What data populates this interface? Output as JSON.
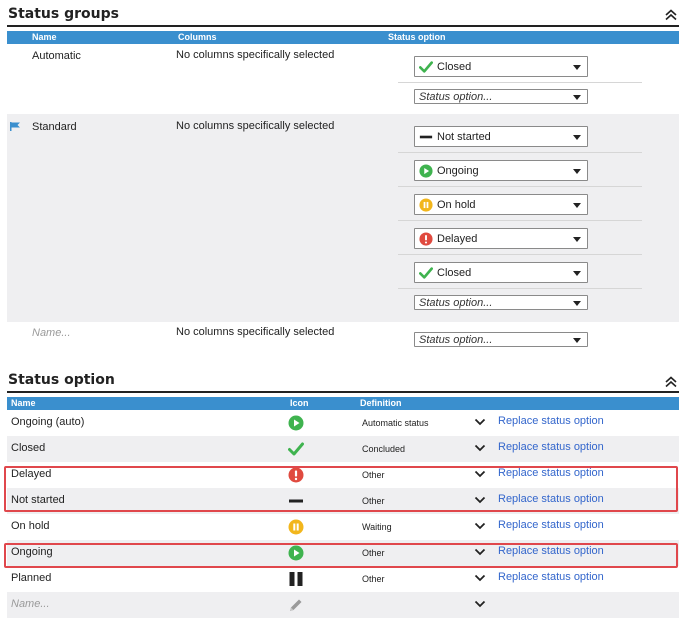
{
  "status_groups": {
    "title": "Status groups",
    "headers": {
      "name": "Name",
      "columns": "Columns",
      "status_option": "Status option"
    },
    "groups": [
      {
        "name": "Automatic",
        "columns": "No columns specifically selected",
        "options": [
          "Closed"
        ],
        "add_placeholder": "Status option..."
      },
      {
        "name": "Standard",
        "columns": "No columns specifically selected",
        "options": [
          "Not started",
          "Ongoing",
          "On hold",
          "Delayed",
          "Closed"
        ],
        "add_placeholder": "Status option..."
      }
    ],
    "new_row": {
      "name_placeholder": "Name...",
      "columns": "No columns specifically selected",
      "add_placeholder": "Status option..."
    }
  },
  "status_option": {
    "title": "Status option",
    "headers": {
      "name": "Name",
      "icon": "Icon",
      "definition": "Definition"
    },
    "rows": [
      {
        "name": "Ongoing (auto)",
        "icon": "play-circle-green",
        "definition": "Automatic status",
        "action": "Replace status option"
      },
      {
        "name": "Closed",
        "icon": "check-green",
        "definition": "Concluded",
        "action": "Replace status option"
      },
      {
        "name": "Delayed",
        "icon": "exclamation-circle-red",
        "definition": "Other",
        "action": "Replace status option"
      },
      {
        "name": "Not started",
        "icon": "dash-black",
        "definition": "Other",
        "action": "Replace status option"
      },
      {
        "name": "On hold",
        "icon": "pause-circle-yellow",
        "definition": "Waiting",
        "action": "Replace status option"
      },
      {
        "name": "Ongoing",
        "icon": "play-circle-green",
        "definition": "Other",
        "action": "Replace status option"
      },
      {
        "name": "Planned",
        "icon": "pause-bars-black",
        "definition": "Other",
        "action": "Replace status option"
      }
    ],
    "new_row": {
      "name_placeholder": "Name...",
      "icon": "pencil-grey"
    }
  },
  "colors": {
    "header_blue": "#3a8fce",
    "link_blue": "#3366cc",
    "highlight_red": "#e0474c",
    "green": "#3fb34f",
    "yellow": "#f2b61c",
    "red": "#e04a3f"
  }
}
